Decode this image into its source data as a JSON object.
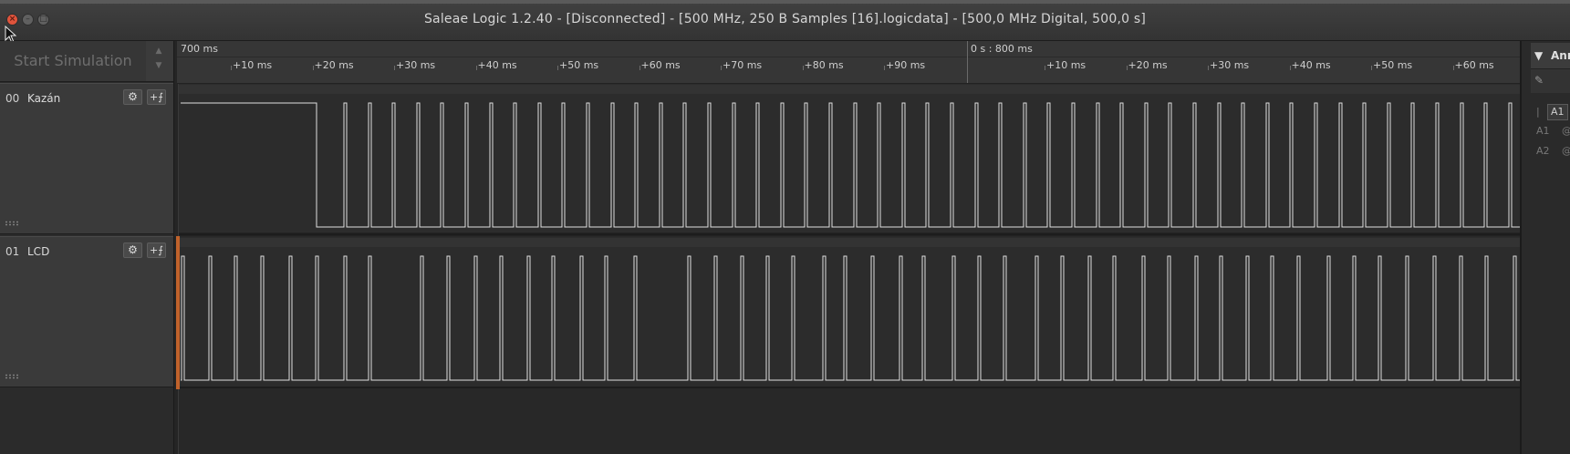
{
  "window": {
    "title": "Saleae Logic 1.2.40 - [Disconnected] - [500 MHz, 250 B Samples [16].logicdata] - [500,0 MHz Digital, 500,0 s]",
    "close_icon": "close-icon",
    "minimize_icon": "minimize-icon",
    "maximize_icon": "maximize-icon"
  },
  "toolbar": {
    "simulation_label": "Start Simulation"
  },
  "timeline": {
    "segment1_label": "700 ms",
    "segment2_label": "0 s : 800 ms",
    "ticks_a": [
      "+10 ms",
      "+20 ms",
      "+30 ms",
      "+40 ms",
      "+50 ms",
      "+60 ms",
      "+70 ms",
      "+80 ms",
      "+90 ms"
    ],
    "ticks_b": [
      "+10 ms",
      "+20 ms",
      "+30 ms",
      "+40 ms",
      "+50 ms",
      "+60 ms"
    ]
  },
  "channels": [
    {
      "number": "00",
      "name": "Kazán"
    },
    {
      "number": "01",
      "name": "LCD"
    }
  ],
  "right_panel": {
    "header": "Ann",
    "row1_label": "A1",
    "row2_label": "A1",
    "row2_value": "@",
    "row3_label": "A2",
    "row3_value": "@",
    "toolbar_glyph": "|"
  },
  "colors": {
    "trace": "#e0e0e0",
    "accent_marker": "#c0622b",
    "background": "#282828"
  }
}
